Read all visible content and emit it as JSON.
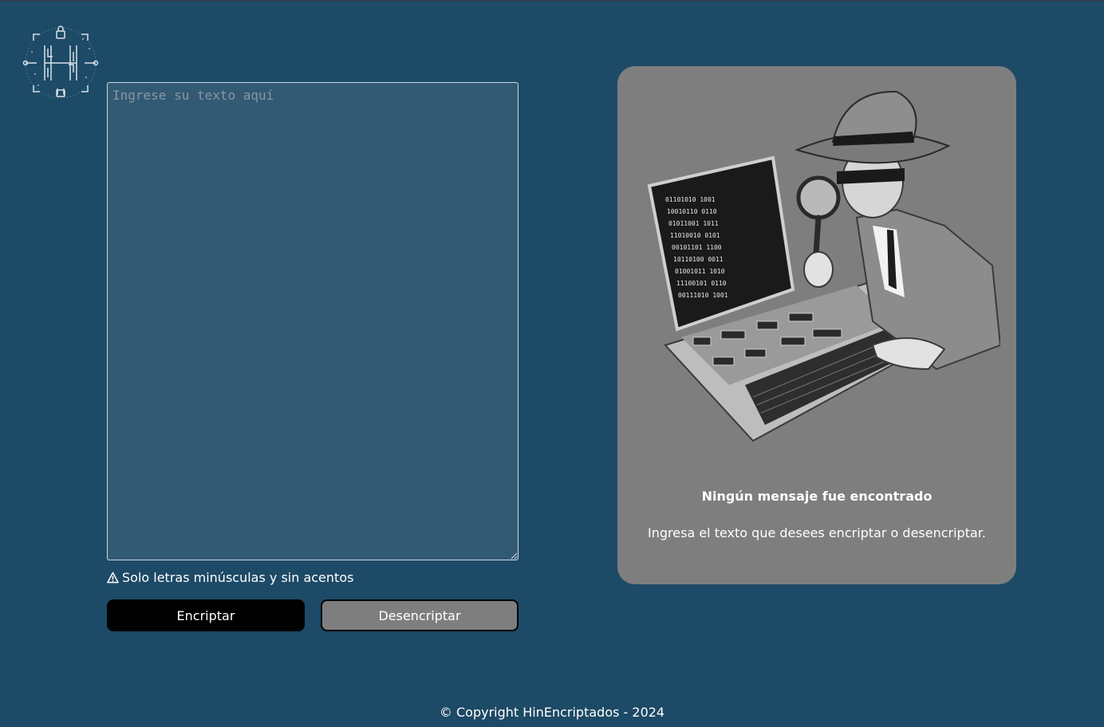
{
  "input": {
    "placeholder": "Ingrese su texto aquí",
    "value": ""
  },
  "warning": {
    "icon": "warning-triangle-icon",
    "text": "Solo letras minúsculas y sin acentos"
  },
  "buttons": {
    "encrypt_label": "Encriptar",
    "decrypt_label": "Desencriptar"
  },
  "output_panel": {
    "illustration": "detective-laptop-illustration",
    "title": "Ningún mensaje fue encontrado",
    "message": "Ingresa el texto que desees encriptar o desencriptar."
  },
  "footer": {
    "copyright": "© Copyright HinEncriptados - 2024"
  },
  "colors": {
    "background": "#1d4a66",
    "textarea": "#325a75",
    "panel": "#7e7e7e",
    "encrypt_button": "#000000",
    "decrypt_button": "#7e7e7e"
  }
}
